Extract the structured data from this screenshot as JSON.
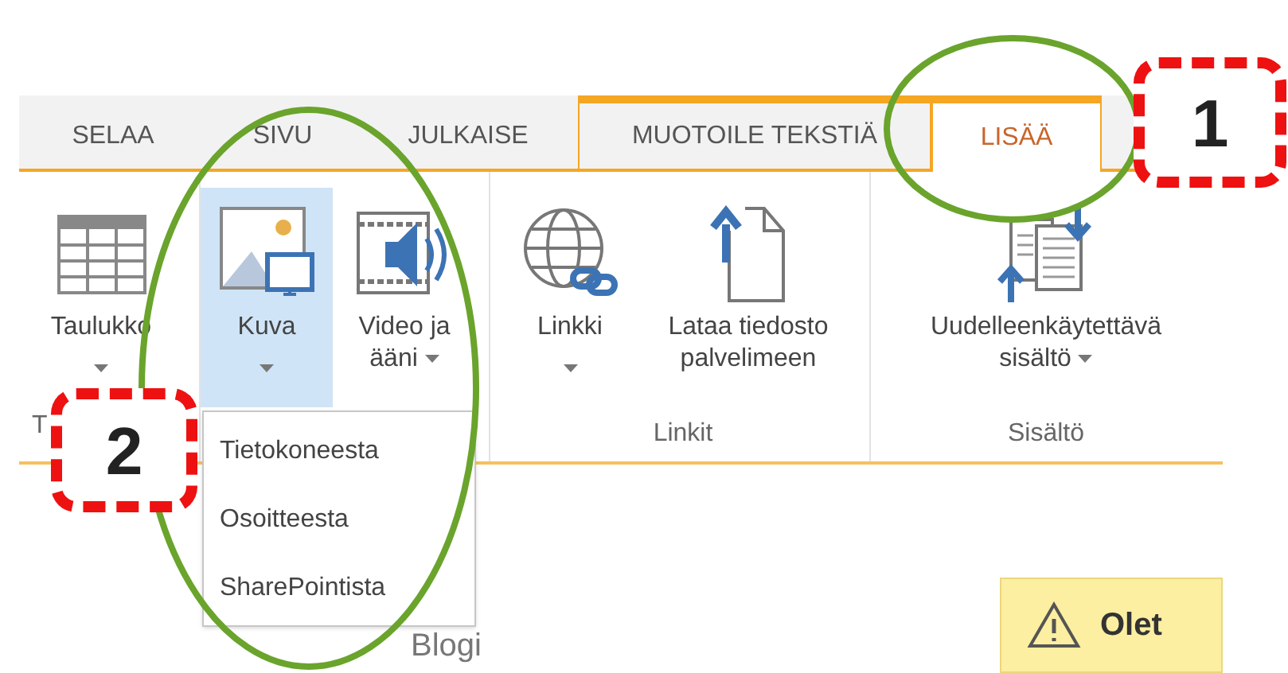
{
  "tabs": [
    {
      "label": "SELAA",
      "selected": false,
      "contextual": false
    },
    {
      "label": "SIVU",
      "selected": false,
      "contextual": false
    },
    {
      "label": "JULKAISE",
      "selected": false,
      "contextual": false
    },
    {
      "label": "MUOTOILE TEKSTIÄ",
      "selected": false,
      "contextual": true
    },
    {
      "label": "LISÄÄ",
      "selected": true,
      "contextual": true
    }
  ],
  "groups": [
    {
      "label": "T",
      "buttons": [
        {
          "lines": [
            "Taulukko"
          ],
          "dropdown": true,
          "selected": false
        }
      ]
    },
    {
      "buttons": [
        {
          "lines": [
            "Kuva"
          ],
          "dropdown": true,
          "selected": true
        },
        {
          "lines": [
            "Video ja",
            "ääni"
          ],
          "dropdown": true,
          "selected": false
        }
      ]
    },
    {
      "label": "Linkit",
      "buttons": [
        {
          "lines": [
            "Linkki"
          ],
          "dropdown": true,
          "selected": false
        },
        {
          "lines": [
            "Lataa tiedosto",
            "palvelimeen"
          ],
          "dropdown": false,
          "selected": false
        }
      ]
    },
    {
      "label": "Sisältö",
      "buttons": [
        {
          "lines": [
            "Uudelleenkäytettävä",
            "sisältö"
          ],
          "dropdown": true,
          "selected": false
        }
      ]
    }
  ],
  "dropdown_menu": {
    "items": [
      "Tietokoneesta",
      "Osoitteesta",
      "SharePointista"
    ]
  },
  "page": {
    "heading": "Blogi"
  },
  "notice": {
    "text": "Olet"
  },
  "annotations": [
    {
      "number": "1"
    },
    {
      "number": "2"
    }
  ]
}
